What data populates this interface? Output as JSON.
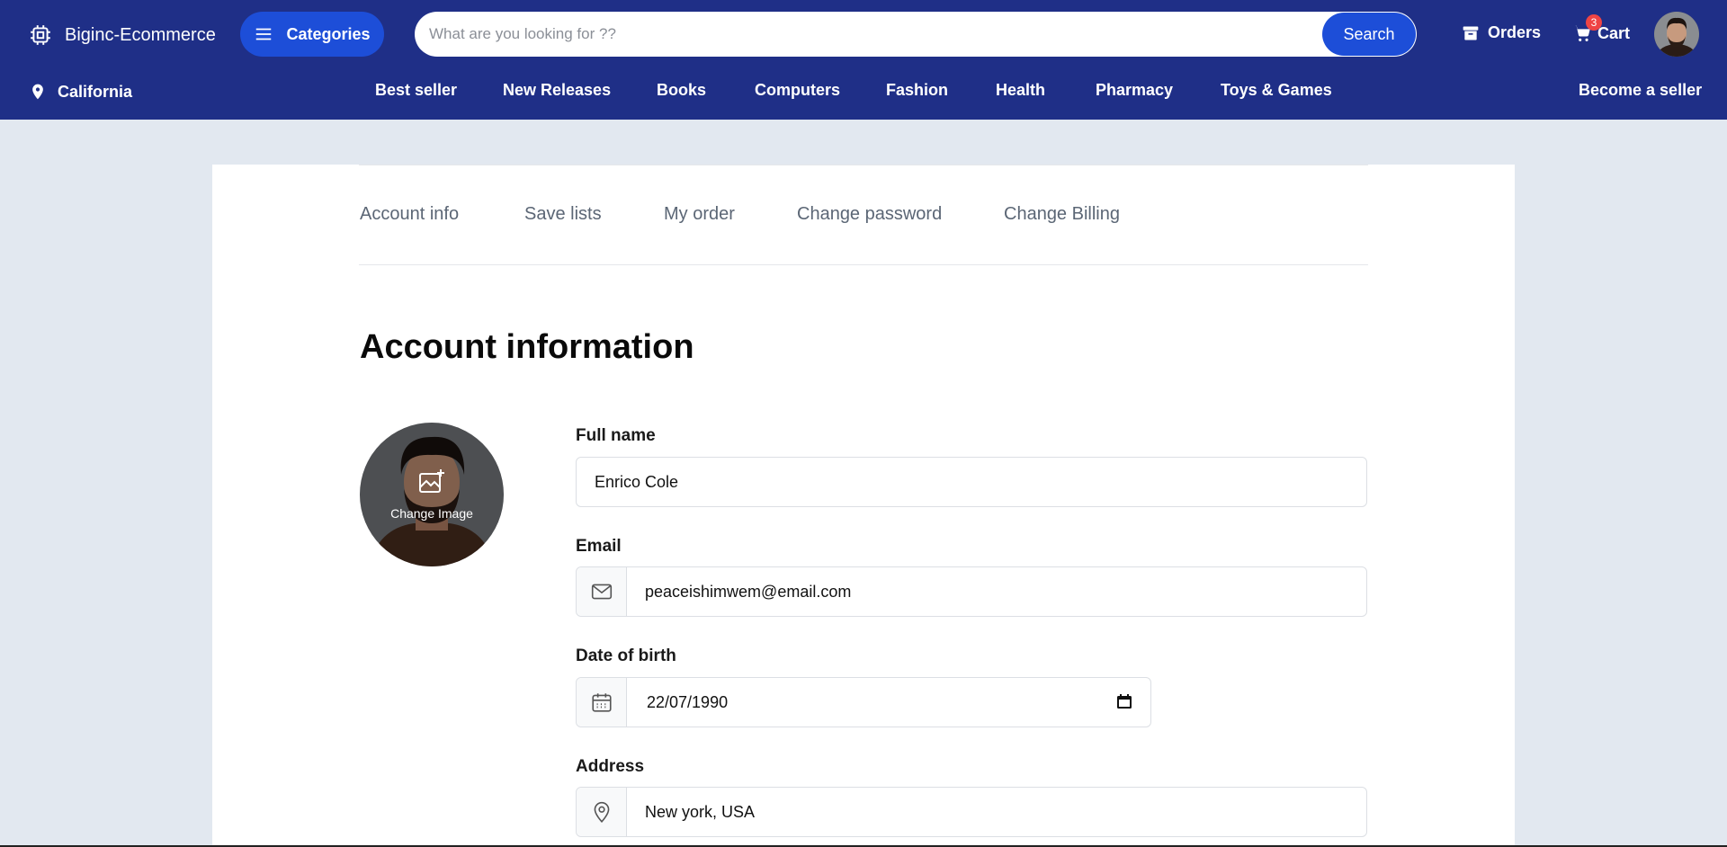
{
  "header": {
    "brand": "Biginc-Ecommerce",
    "categories_label": "Categories",
    "search_placeholder": "What are you looking for ??",
    "search_value": "",
    "search_button": "Search",
    "orders_label": "Orders",
    "cart_label": "Cart",
    "cart_count": "3",
    "location": "California",
    "nav_items": [
      "Best seller",
      "New Releases",
      "Books",
      "Computers",
      "Fashion",
      "Health",
      "Pharmacy",
      "Toys & Games"
    ],
    "become_seller": "Become a seller"
  },
  "tabs": [
    "Account info",
    "Save lists",
    "My order",
    "Change password",
    "Change Billing"
  ],
  "page_title": "Account information",
  "profile": {
    "change_image_label": "Change Image"
  },
  "form": {
    "full_name_label": "Full name",
    "full_name_value": "Enrico Cole",
    "email_label": "Email",
    "email_value": "peaceishimwem@email.com",
    "dob_label": "Date of birth",
    "dob_value": "22/07/1990",
    "address_label": "Address",
    "address_value": "New york, USA"
  },
  "colors": {
    "header_bg": "#1f2f87",
    "accent": "#1d4ed8",
    "page_bg": "#e2e8f0",
    "badge": "#ef4444"
  }
}
